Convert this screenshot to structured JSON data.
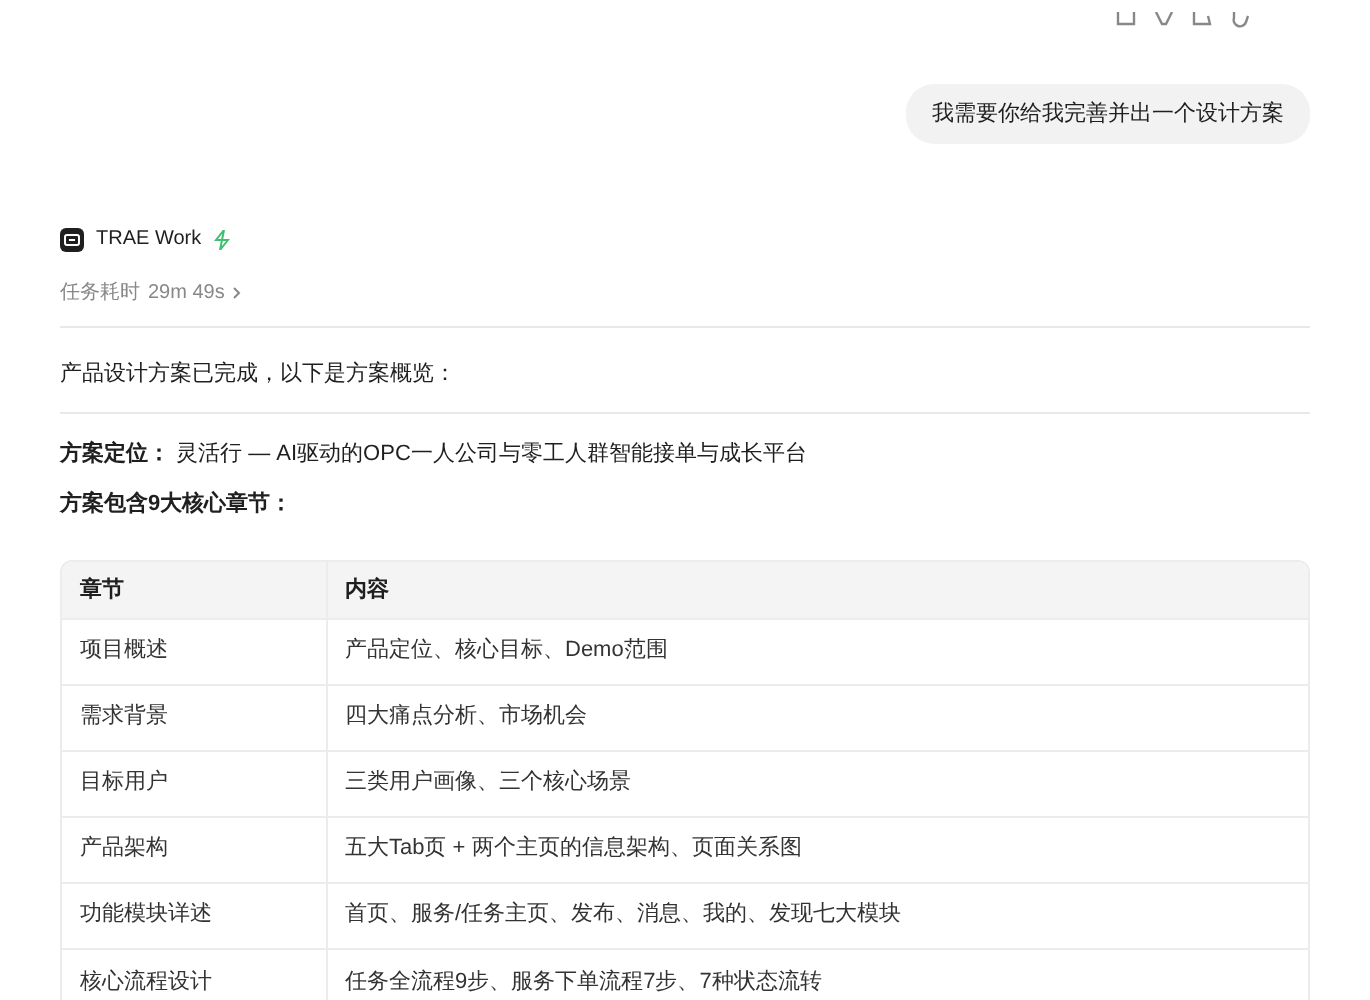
{
  "user_message": "我需要你给我完善并出一个设计方案",
  "agent": {
    "name": "TRAE Work",
    "duration_label": "任务耗时",
    "duration": "29m 49s"
  },
  "summary": "产品设计方案已完成，以下是方案概览：",
  "positioning": {
    "label": "方案定位：",
    "text": "灵活行 — AI驱动的OPC一人公司与零工人群智能接单与成长平台"
  },
  "chapters_heading": "方案包含9大核心章节：",
  "table": {
    "columns": [
      "章节",
      "内容"
    ],
    "rows": [
      [
        "项目概述",
        "产品定位、核心目标、Demo范围"
      ],
      [
        "需求背景",
        "四大痛点分析、市场机会"
      ],
      [
        "目标用户",
        "三类用户画像、三个核心场景"
      ],
      [
        "产品架构",
        "五大Tab页 + 两个主页的信息架构、页面关系图"
      ],
      [
        "功能模块详述",
        "首页、服务/任务主页、发布、消息、我的、发现七大模块"
      ],
      [
        "核心流程设计",
        "任务全流程9步、服务下单流程7步、7种状态流转"
      ]
    ]
  }
}
